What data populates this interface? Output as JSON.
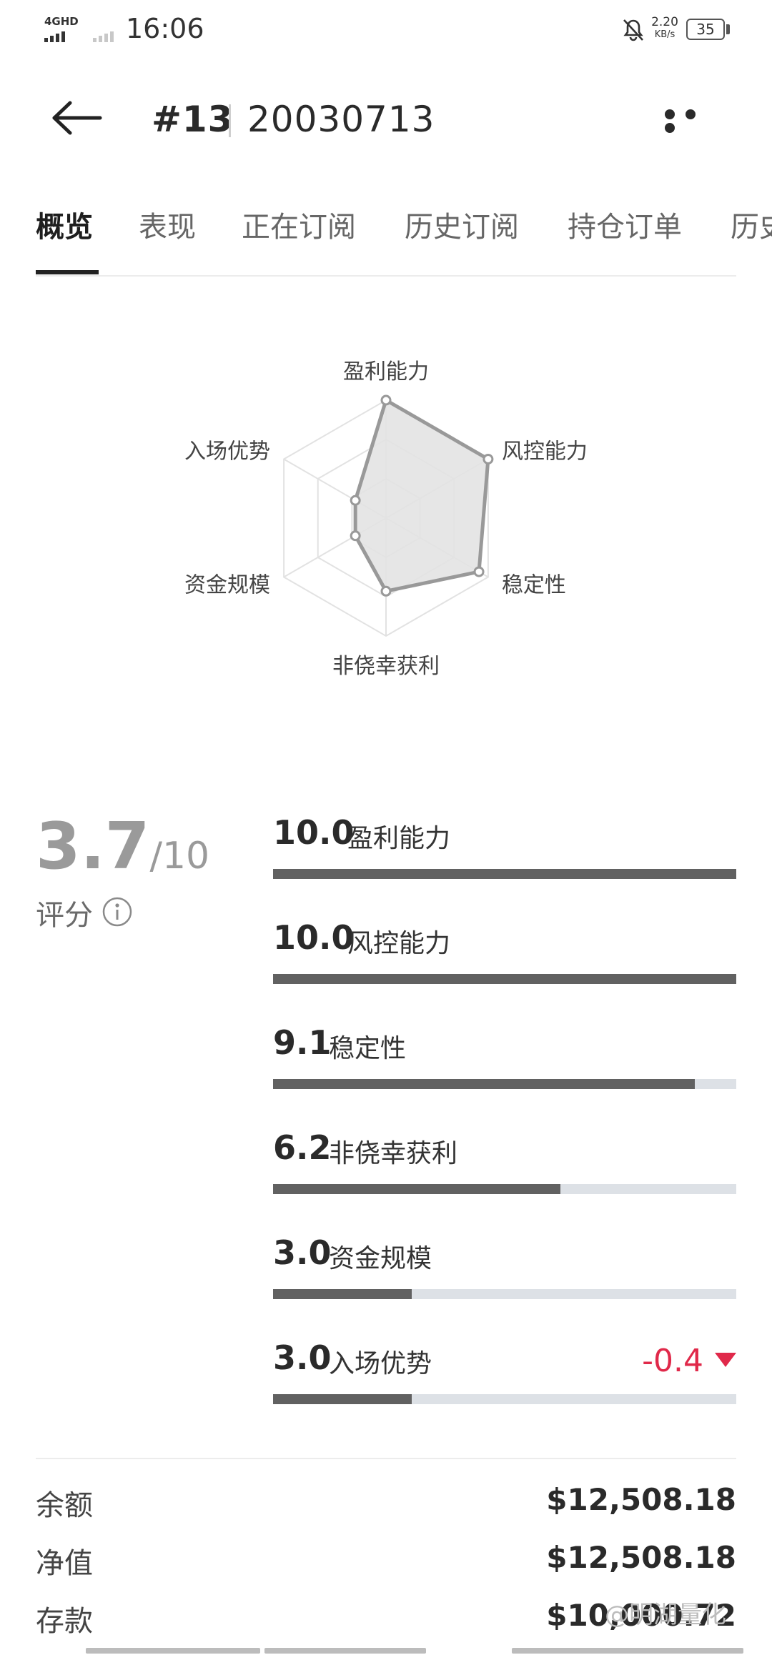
{
  "status_bar": {
    "network": "4GHD",
    "time": "16:06",
    "net_speed_value": "2.20",
    "net_speed_unit": "KB/s",
    "battery": "35"
  },
  "header": {
    "rank": "#13",
    "account_id": "20030713"
  },
  "tabs": [
    {
      "label": "概览",
      "active": true
    },
    {
      "label": "表现",
      "active": false
    },
    {
      "label": "正在订阅",
      "active": false
    },
    {
      "label": "历史订阅",
      "active": false
    },
    {
      "label": "持仓订单",
      "active": false
    },
    {
      "label": "历史",
      "active": false
    }
  ],
  "chart_data": {
    "type": "radar",
    "axes": [
      "盈利能力",
      "风控能力",
      "稳定性",
      "非侥幸获利",
      "资金规模",
      "入场优势"
    ],
    "values": [
      10.0,
      10.0,
      9.1,
      6.2,
      3.0,
      3.0
    ],
    "range": [
      0,
      10
    ],
    "grid_levels": 3
  },
  "score": {
    "value": "3.7",
    "denominator": "/10",
    "label": "评分"
  },
  "metrics": [
    {
      "value": "10.0",
      "name": "盈利能力",
      "fraction": 1.0
    },
    {
      "value": "10.0",
      "name": "风控能力",
      "fraction": 1.0
    },
    {
      "value": "9.1",
      "name": "稳定性",
      "fraction": 0.91
    },
    {
      "value": "6.2",
      "name": "非侥幸获利",
      "fraction": 0.62
    },
    {
      "value": "3.0",
      "name": "资金规模",
      "fraction": 0.3
    },
    {
      "value": "3.0",
      "name": "入场优势",
      "fraction": 0.3,
      "delta": "-0.4"
    }
  ],
  "summary": [
    {
      "label": "余额",
      "value": "$12,508.18"
    },
    {
      "label": "净值",
      "value": "$12,508.18"
    },
    {
      "label": "存款",
      "value": "$10,000.72"
    }
  ],
  "watermark": "@明湖量化",
  "colors": {
    "accent_negative": "#e0294a",
    "bar_fill": "#616161",
    "bar_track": "#dde1e6",
    "radar_stroke": "#999999",
    "radar_fill": "#e3e3e3"
  }
}
